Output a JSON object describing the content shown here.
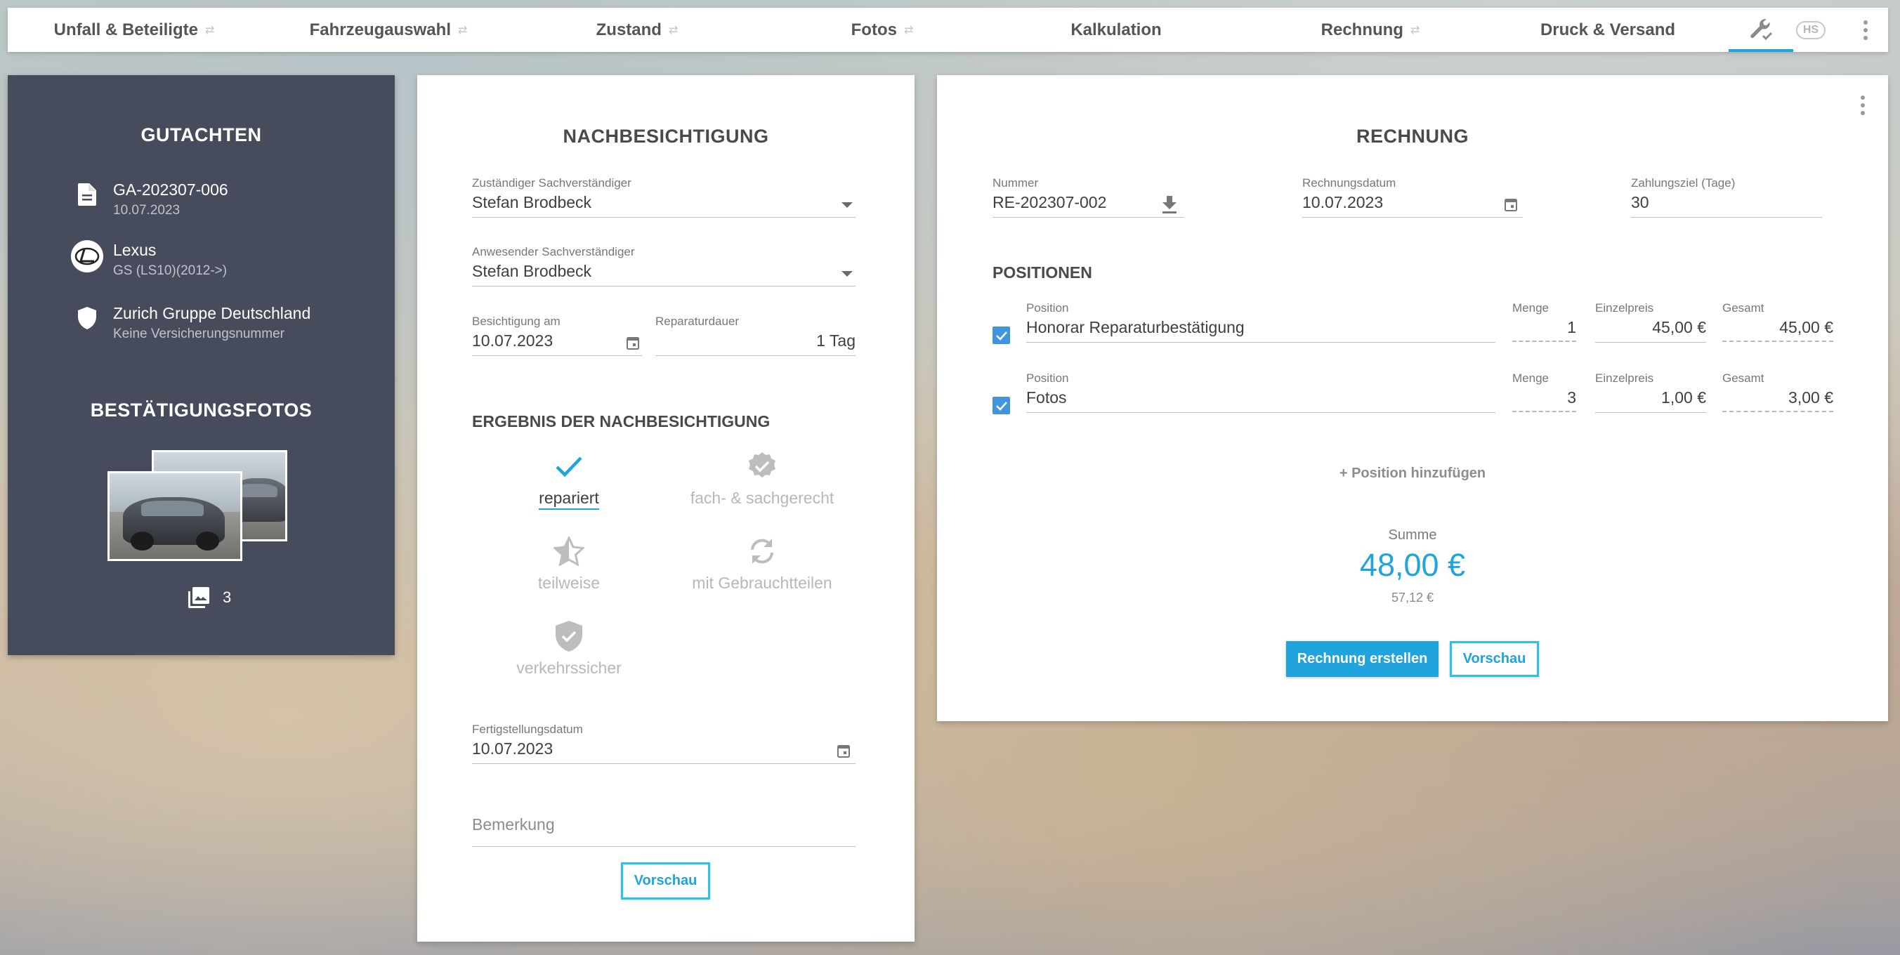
{
  "nav": {
    "tabs": [
      {
        "label": "Unfall & Beteiligte"
      },
      {
        "label": "Fahrzeugauswahl"
      },
      {
        "label": "Zustand"
      },
      {
        "label": "Fotos"
      },
      {
        "label": "Kalkulation"
      },
      {
        "label": "Rechnung"
      },
      {
        "label": "Druck & Versand"
      }
    ],
    "user_badge": "HS",
    "active_tool_icon": "wrench-check-icon",
    "accent_color": "#21a3dd"
  },
  "gutachten": {
    "title": "GUTACHTEN",
    "report_number": "GA-202307-006",
    "report_date": "10.07.2023",
    "vehicle_make": "Lexus",
    "vehicle_model": "GS (LS10)(2012->)",
    "insurance_name": "Zurich Gruppe Deutschland",
    "insurance_number": "Keine Versicherungsnummer",
    "photos_title": "BESTÄTIGUNGSFOTOS",
    "photo_count": "3",
    "background_color": "#464c5b"
  },
  "nachbesichtigung": {
    "title": "NACHBESICHTIGUNG",
    "responsible_label": "Zuständiger Sachverständiger",
    "responsible_value": "Stefan Brodbeck",
    "present_label": "Anwesender Sachverständiger",
    "present_value": "Stefan Brodbeck",
    "inspection_date_label": "Besichtigung am",
    "inspection_date_value": "10.07.2023",
    "repair_duration_label": "Reparaturdauer",
    "repair_duration_value": "1 Tag",
    "result_title": "ERGEBNIS DER NACHBESICHTIGUNG",
    "results": [
      {
        "label": "repariert",
        "icon": "check-icon",
        "active": true
      },
      {
        "label": "fach- & sachgerecht",
        "icon": "verified-badge-icon",
        "active": false
      },
      {
        "label": "teilweise",
        "icon": "half-star-icon",
        "active": false
      },
      {
        "label": "mit Gebrauchtteilen",
        "icon": "recycle-icon",
        "active": false
      },
      {
        "label": "verkehrssicher",
        "icon": "shield-check-icon",
        "active": false
      }
    ],
    "completion_date_label": "Fertigstellungsdatum",
    "completion_date_value": "10.07.2023",
    "remark_placeholder": "Bemerkung",
    "preview_button": "Vorschau"
  },
  "rechnung": {
    "title": "RECHNUNG",
    "number_label": "Nummer",
    "number_value": "RE-202307-002",
    "date_label": "Rechnungsdatum",
    "date_value": "10.07.2023",
    "payment_label": "Zahlungsziel (Tage)",
    "payment_value": "30",
    "positions_title": "POSITIONEN",
    "columns": {
      "position": "Position",
      "quantity": "Menge",
      "unit_price": "Einzelpreis",
      "total": "Gesamt"
    },
    "positions": [
      {
        "checked": true,
        "description": "Honorar Reparaturbestätigung",
        "quantity": "1",
        "unit_price": "45,00 €",
        "total": "45,00 €"
      },
      {
        "checked": true,
        "description": "Fotos",
        "quantity": "3",
        "unit_price": "1,00 €",
        "total": "3,00 €"
      }
    ],
    "add_position": "+ Position hinzufügen",
    "sum_label": "Summe",
    "sum_net": "48,00 €",
    "sum_gross": "57,12 €",
    "create_button": "Rechnung erstellen",
    "preview_button": "Vorschau"
  }
}
